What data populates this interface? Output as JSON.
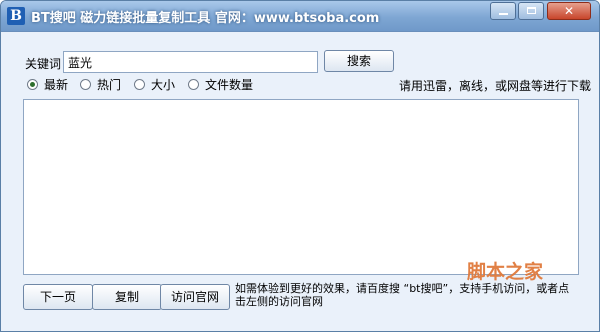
{
  "window": {
    "title": "BT搜吧 磁力链接批量复制工具 官网：www.btsoba.com",
    "logo_letter": "B",
    "controls": {
      "minimize": "min",
      "maximize": "max",
      "close": "✕"
    }
  },
  "search": {
    "keyword_label": "关键词",
    "keyword_value": "蓝光",
    "search_button": "搜索"
  },
  "sort_options": [
    {
      "label": "最新",
      "selected": true
    },
    {
      "label": "热门",
      "selected": false
    },
    {
      "label": "大小",
      "selected": false
    },
    {
      "label": "文件数量",
      "selected": false
    }
  ],
  "hint_top": "请用迅雷，离线，或网盘等进行下载",
  "results_text": "",
  "buttons": {
    "next_page": "下一页",
    "copy": "复制",
    "visit_site": "访问官网"
  },
  "bottom_hint": "如需体验到更好的效果，请百度搜 “bt搜吧”，支持手机访问，或者点击左侧的访问官网",
  "watermark": "脚本之家"
}
